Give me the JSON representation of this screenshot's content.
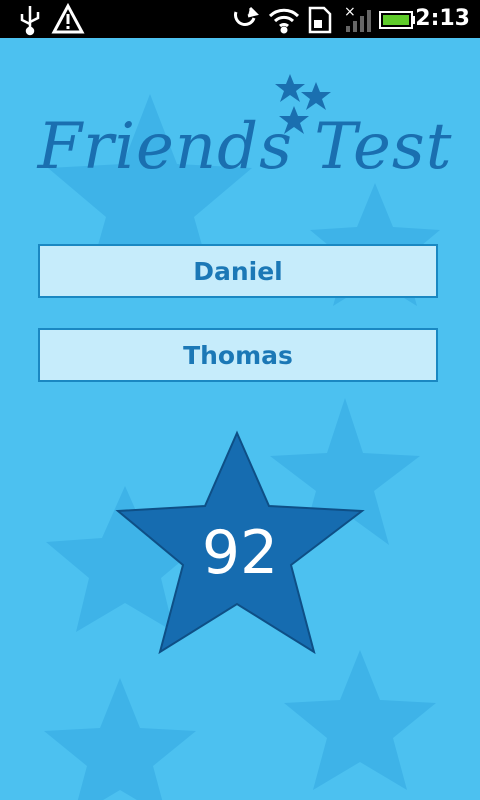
{
  "status_bar": {
    "time": "2:13",
    "icons": [
      "usb-icon",
      "warning-icon",
      "sync-icon",
      "wifi-icon",
      "sd-card-icon",
      "signal-icon",
      "battery-icon"
    ]
  },
  "app": {
    "title": "Friends Test",
    "name1": "Daniel",
    "name2": "Thomas",
    "score": "92"
  },
  "colors": {
    "background": "#4cc1f0",
    "accent": "#1a6fb0",
    "field_bg": "#c6ecfb"
  }
}
